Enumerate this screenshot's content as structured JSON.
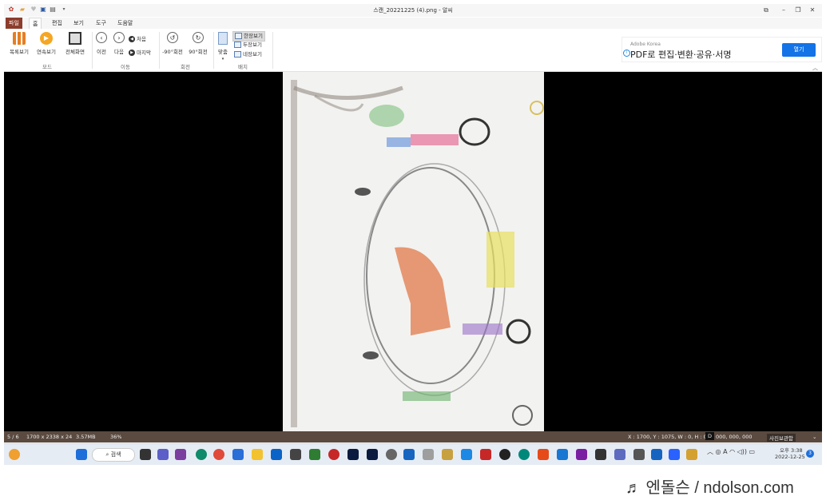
{
  "window": {
    "title": "스캔_20221225 (4).png - 알씨",
    "quick_access": [
      "app-icon",
      "folder-icon",
      "heart-icon",
      "save-icon",
      "print-icon",
      "dropdown-icon"
    ],
    "controls": [
      "restore-icon",
      "minimize-icon",
      "maximize-icon",
      "close-icon"
    ]
  },
  "tabs": [
    "파일",
    "홈",
    "편집",
    "보기",
    "도구",
    "도움말"
  ],
  "ribbon": {
    "mode": {
      "group": "모드",
      "list_view": "목록보기",
      "slideshow": "연속보기",
      "fullscreen": "전체화면"
    },
    "move": {
      "group": "이동",
      "prev": "이전",
      "next": "다음",
      "first": "처음",
      "last": "마지막"
    },
    "rotate": {
      "group": "회전",
      "ccw": "-90°회전",
      "cw": "90°회전"
    },
    "layout": {
      "group": "배치",
      "fit": "맞춤",
      "options": [
        "한장보기",
        "두장보기",
        "네장보기"
      ],
      "selected": "한장보기"
    }
  },
  "ad": {
    "brand": "Adobe Korea",
    "text": "PDF로 편집·변환·공유·서명",
    "button": "열기"
  },
  "status": {
    "index": "5 / 6",
    "dimensions": "1700 x 2338 x 24",
    "filesize": "3.57MB",
    "zoom": "36%",
    "coords": "X : 1700, Y : 1075, W : 0, H : 0",
    "color_label": "D",
    "color_value": "000, 000, 000",
    "photo_mgmt": "사진보관함"
  },
  "taskbar": {
    "search": "검색",
    "time_period": "오후 3:38",
    "date": "2022-12-25",
    "notification_count": "3"
  },
  "watermark": "♬ 엔돌슨 / ndolson.com",
  "colors": {
    "file_tab": "#8c3d2c",
    "status_bar": "#5a4a40",
    "accent": "#1473e6"
  }
}
